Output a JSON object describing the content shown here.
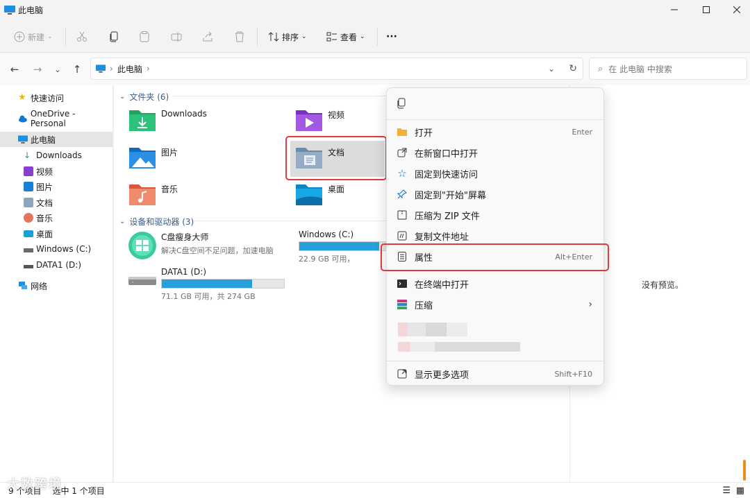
{
  "window": {
    "title": "此电脑"
  },
  "toolbar": {
    "new_label": "新建",
    "sort_label": "排序",
    "view_label": "查看",
    "more_label": "···"
  },
  "address": {
    "crumb": "此电脑"
  },
  "search": {
    "placeholder": "在 此电脑 中搜索"
  },
  "sidebar": {
    "items": [
      {
        "label": "快速访问"
      },
      {
        "label": "OneDrive - Personal"
      },
      {
        "label": "此电脑"
      },
      {
        "label": "Downloads"
      },
      {
        "label": "视频"
      },
      {
        "label": "图片"
      },
      {
        "label": "文档"
      },
      {
        "label": "音乐"
      },
      {
        "label": "桌面"
      },
      {
        "label": "Windows (C:)"
      },
      {
        "label": "DATA1 (D:)"
      },
      {
        "label": "网络"
      }
    ]
  },
  "main": {
    "folders_header": "文件夹 (6)",
    "folders": [
      {
        "label": "Downloads"
      },
      {
        "label": "视频"
      },
      {
        "label": "图片"
      },
      {
        "label": "文档"
      },
      {
        "label": "音乐"
      },
      {
        "label": "桌面"
      }
    ],
    "devices_header": "设备和驱动器 (3)",
    "devices": [
      {
        "name": "C盘瘦身大师",
        "desc": "解决C盘空间不足问题，加速电脑"
      },
      {
        "name": "Windows (C:)",
        "desc": "22.9 GB 可用，",
        "used_fraction": 0.83
      },
      {
        "name": "DATA1 (D:)",
        "desc": "71.1 GB 可用，共 274 GB",
        "used_fraction": 0.74
      }
    ],
    "preview_text": "没有预览。"
  },
  "context_menu": {
    "items": [
      {
        "label": "打开",
        "shortcut": "Enter"
      },
      {
        "label": "在新窗口中打开",
        "shortcut": ""
      },
      {
        "label": "固定到快速访问",
        "shortcut": ""
      },
      {
        "label": "固定到\"开始\"屏幕",
        "shortcut": ""
      },
      {
        "label": "压缩为 ZIP 文件",
        "shortcut": ""
      },
      {
        "label": "复制文件地址",
        "shortcut": ""
      },
      {
        "label": "属性",
        "shortcut": "Alt+Enter"
      },
      {
        "label": "在终端中打开",
        "shortcut": ""
      },
      {
        "label": "压缩",
        "shortcut": ""
      },
      {
        "label": "显示更多选项",
        "shortcut": "Shift+F10"
      }
    ]
  },
  "status": {
    "item_count": "9 个项目",
    "selected": "选中 1 个项目"
  },
  "watermark": "大数跨境",
  "colors": {
    "accent": "#0067c0",
    "highlight_box": "#e0393e",
    "drive_fill": "#26a0da"
  }
}
